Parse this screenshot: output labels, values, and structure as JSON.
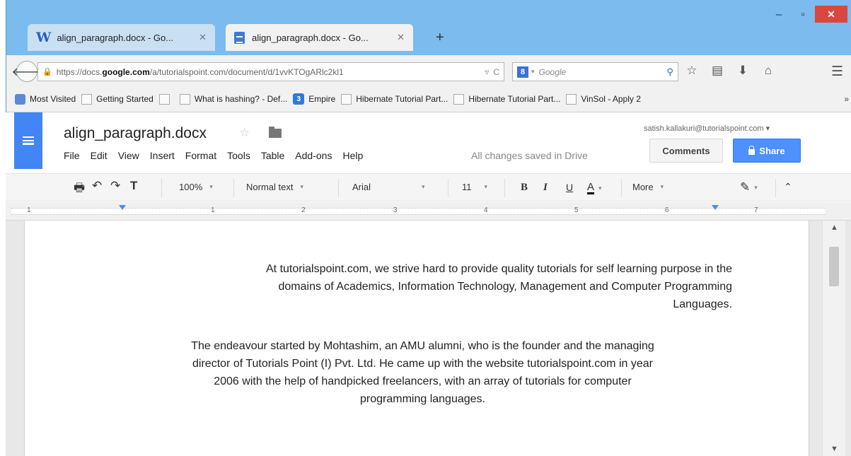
{
  "browser": {
    "tabs": [
      {
        "label": "align_paragraph.docx - Go...",
        "favicon": "W",
        "active": false
      },
      {
        "label": "align_paragraph.docx - Go...",
        "active": true
      }
    ],
    "new_tab": "+",
    "window": {
      "minimize": "‒",
      "maximize": "▫",
      "close": "✕"
    },
    "url_prefix": "https://docs.",
    "url_domain": "google.com",
    "url_rest": "/a/tutorialspoint.com/document/d/1vvKTOgARlc2kl1",
    "search_placeholder": "Google",
    "search_engine_letter": "8",
    "bookmarks": [
      {
        "label": "Most Visited"
      },
      {
        "label": "Getting Started"
      },
      {
        "label": ""
      },
      {
        "label": "What is hashing? - Def..."
      },
      {
        "label": "Empire"
      },
      {
        "label": "Hibernate Tutorial Part..."
      },
      {
        "label": "Hibernate Tutorial Part..."
      },
      {
        "label": "VinSol - Apply 2"
      }
    ],
    "bookmarks_more": "»"
  },
  "docs": {
    "title": "align_paragraph.docx",
    "menu": [
      "File",
      "Edit",
      "View",
      "Insert",
      "Format",
      "Tools",
      "Table",
      "Add-ons",
      "Help"
    ],
    "save_status": "All changes saved in Drive",
    "user_email": "satish.kallakuri@tutorialspoint.com ▾",
    "comments_label": "Comments",
    "share_label": "Share",
    "toolbar": {
      "zoom": "100%",
      "style": "Normal text",
      "font": "Arial",
      "size": "11",
      "bold": "B",
      "italic": "I",
      "underline": "U",
      "text_color": "A",
      "more": "More"
    },
    "ruler_numbers": [
      "1",
      "1",
      "2",
      "3",
      "4",
      "5",
      "6",
      "7"
    ],
    "paragraphs": [
      {
        "align": "right",
        "lines": [
          "At tutorialspoint.com, we strive hard to provide quality tutorials for self learning purpose in the",
          "domains of Academics, Information Technology, Management and Computer Programming",
          "Languages."
        ]
      },
      {
        "align": "center",
        "lines": [
          "The endeavour started by Mohtashim, an AMU alumni, who is the founder and the managing",
          "director of Tutorials Point (I) Pvt. Ltd. He came up with the website tutorialspoint.com in year",
          "2006 with the help of handpicked freelancers, with an array of tutorials for computer",
          "programming languages."
        ]
      }
    ]
  }
}
